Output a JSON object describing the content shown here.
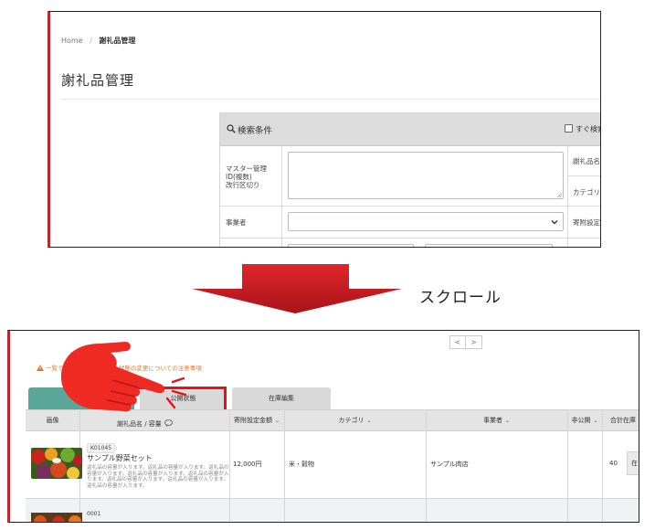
{
  "top_panel": {
    "breadcrumb": {
      "home": "Home",
      "separator": "/",
      "current": "謝礼品管理"
    },
    "page_title": "謝礼品管理",
    "search": {
      "header": "検索条件",
      "instant_search_label": "すぐ検索",
      "master_id_label_lines": [
        "マスター管理",
        "ID(複数)",
        "改行区切り"
      ],
      "gift_name_label": "謝礼品名",
      "category_label": "カテゴリ",
      "business_label": "事業者",
      "donation_label": "寄附設定金"
    }
  },
  "scroll_label": "スクロール",
  "bottom_panel": {
    "pager": {
      "prev": "<",
      "next": ">"
    },
    "warning": {
      "part1": "一覧で",
      "part2": "状態の変更についての注意事項"
    },
    "tabs": [
      {
        "label": ""
      },
      {
        "label": "公開状態"
      },
      {
        "label": "在庫編集"
      }
    ],
    "table": {
      "headers": {
        "image": "画像",
        "name_top": "",
        "name_sub": "謝礼品名 / 容量",
        "donation": "寄附設定金額",
        "category": "カテゴリ",
        "business": "事業者",
        "private": "非公開",
        "total_stock": "合計在庫"
      },
      "sort_glyph": "⌄",
      "rows": [
        {
          "code": "K01045",
          "name": "サンプル野菜セット",
          "description": "返礼品の容量が入ります。返礼品の容量が入ります。返礼品の容量が入ります。返礼品の容量が入ります。返礼品の容量が入ります。返礼品の容量が入ります。返礼品の容量が入ります。返礼品の容量が入ります。",
          "donation": "12,000円",
          "category": "米・穀物",
          "business": "サンプル肉店",
          "stock": "40",
          "stock_button": "在"
        },
        {
          "code": "0001"
        }
      ]
    }
  },
  "colors": {
    "accent_red": "#c0272d",
    "highlight_red": "#e8111a",
    "tab_active": "#5aa699",
    "warning_orange": "#e07b2e",
    "arrow_red": "#c8171c"
  },
  "icons": [
    "search-icon",
    "chevron-down-icon",
    "warning-icon",
    "comment-icon",
    "pointing-hand-icon",
    "down-arrow-icon"
  ]
}
